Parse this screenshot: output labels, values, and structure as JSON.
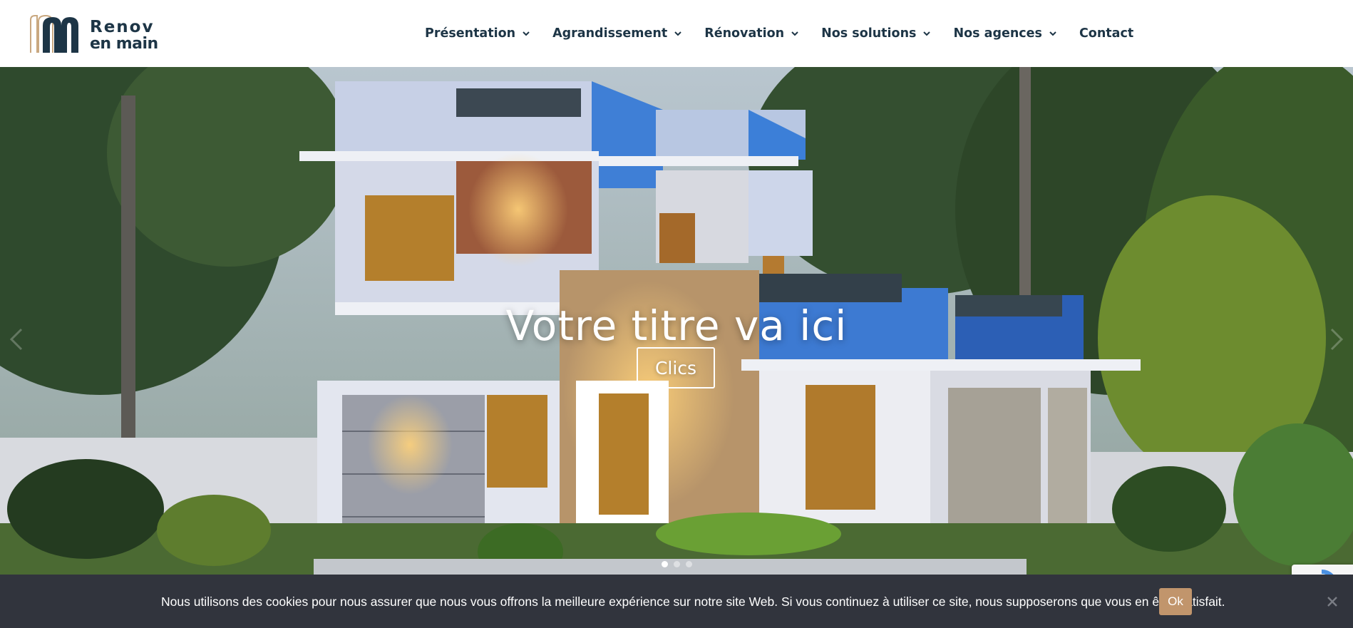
{
  "logo": {
    "line1": "Renov",
    "line2": "en main"
  },
  "nav": {
    "items": [
      {
        "label": "Présentation",
        "has_dropdown": true
      },
      {
        "label": "Agrandissement",
        "has_dropdown": true
      },
      {
        "label": "Rénovation",
        "has_dropdown": true
      },
      {
        "label": "Nos solutions",
        "has_dropdown": true
      },
      {
        "label": "Nos agences",
        "has_dropdown": true
      },
      {
        "label": "Contact",
        "has_dropdown": false
      }
    ]
  },
  "hero": {
    "title": "Votre titre va ici",
    "button_label": "Clics",
    "slides_count": 3,
    "active_slide": 1,
    "arrows": {
      "prev_icon": "chevron-left-icon",
      "next_icon": "chevron-right-icon"
    }
  },
  "cookie_banner": {
    "text": "Nous utilisons des cookies pour nous assurer que nous vous offrons la meilleure expérience sur notre site Web. Si vous continuez à utiliser ce site, nous supposerons que vous en êtes satisfait.",
    "ok_label": "Ok",
    "close_icon": "close-icon"
  },
  "colors": {
    "nav_text": "#1d3546",
    "cookie_bg": "#31343d",
    "ok_button": "#c1956c",
    "logo_accent": "#c9a880"
  }
}
